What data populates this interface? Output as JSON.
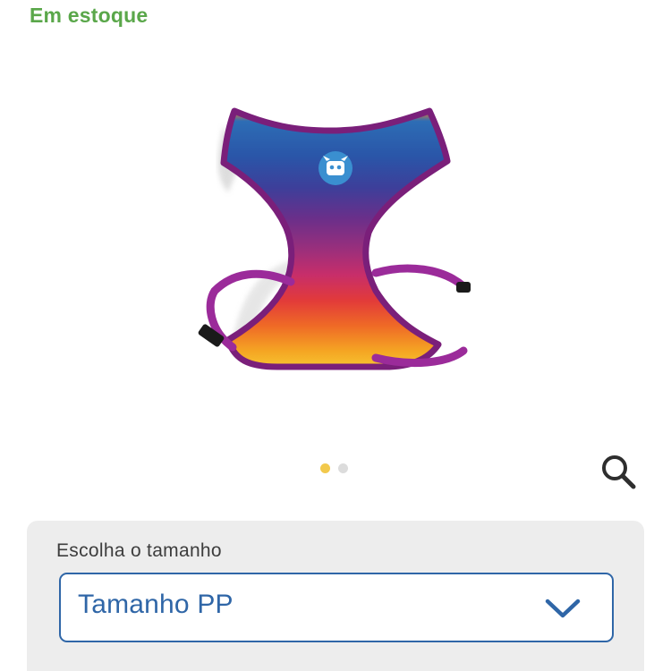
{
  "stock": {
    "status_text": "Em estoque",
    "color": "#5aa74a"
  },
  "product_image": {
    "description_icon": "harness-image"
  },
  "carousel": {
    "total": 2,
    "active_index": 0,
    "active_color": "#f2c94c"
  },
  "zoom": {
    "icon": "search-icon"
  },
  "size_selector": {
    "label": "Escolha o tamanho",
    "selected_value": "Tamanho PP",
    "accent_color": "#2f66a7",
    "icon": "chevron-down-icon"
  }
}
